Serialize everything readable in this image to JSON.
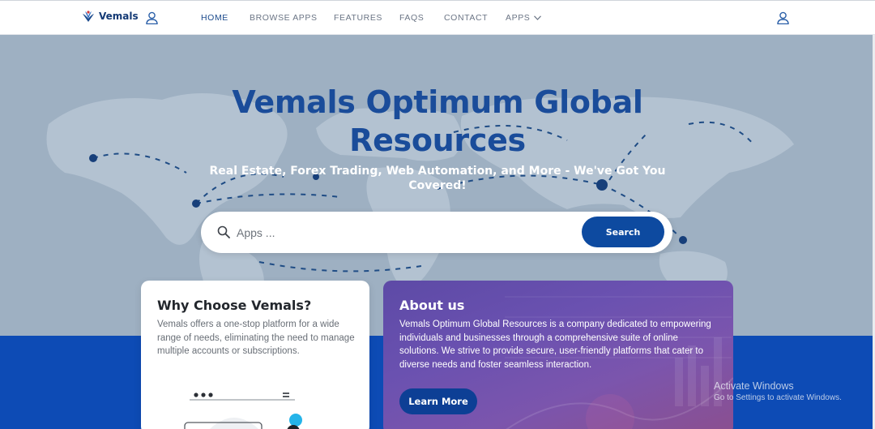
{
  "navbar": {
    "logo_text": "Vemals",
    "links": [
      {
        "label": "HOME",
        "active": true
      },
      {
        "label": "BROWSE APPS",
        "active": false
      },
      {
        "label": "FEATURES",
        "active": false
      },
      {
        "label": "FAQS",
        "active": false
      },
      {
        "label": "CONTACT",
        "active": false
      },
      {
        "label": "APPS",
        "active": false
      }
    ]
  },
  "hero": {
    "title": "Vemals Optimum Global Resources",
    "subtitle": "Real Estate, Forex Trading, Web Automation, and More - We've Got You Covered!",
    "search": {
      "placeholder": "Apps ...",
      "button_label": "Search"
    }
  },
  "why_card": {
    "title": "Why Choose Vemals?",
    "text": "Vemals offers a one-stop platform for a wide range of needs, eliminating the need to manage multiple accounts or subscriptions."
  },
  "about_card": {
    "title": "About us",
    "text": "Vemals Optimum Global Resources is a company dedicated to empowering individuals and businesses through a comprehensive suite of online solutions. We strive to provide secure, user-friendly platforms that cater to diverse needs and foster seamless interaction.",
    "button_label": "Learn More"
  },
  "watermark": {
    "title": "Activate Windows",
    "subtitle": "Go to Settings to activate Windows."
  },
  "colors": {
    "brand_blue": "#0d4aa0",
    "hero_bg": "#9eb0c2",
    "band_blue": "#0d4bb5",
    "title_blue": "#1a4c9a"
  },
  "icons": [
    "vemals-logo-icon",
    "user-icon",
    "chevron-down-icon",
    "search-icon"
  ]
}
